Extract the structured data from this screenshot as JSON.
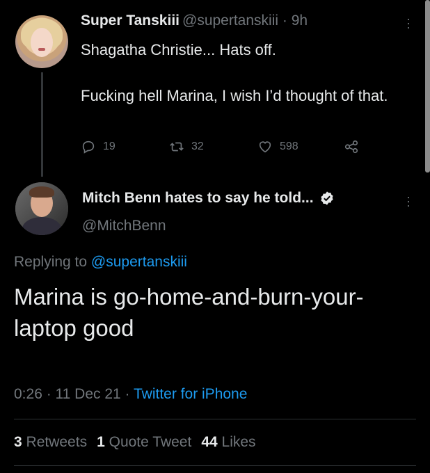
{
  "parent_tweet": {
    "display_name": "Super Tanskiii",
    "handle": "@supertanskiii",
    "time_sep": " · ",
    "time": "9h",
    "text_line1": "Shagatha Christie... Hats off.",
    "text_line2": "Fucking hell Marina, I wish I’d thought of that.",
    "replies": "19",
    "retweets": "32",
    "likes": "598"
  },
  "main_tweet": {
    "display_name": "Mitch Benn hates to say he told...",
    "handle": "@MitchBenn",
    "replying_prefix": "Replying to ",
    "replying_to": "@supertanskiii",
    "text": "Marina is go-home-and-burn-your-laptop good",
    "timestamp": "0:26 · 11 Dec 21 · ",
    "source": "Twitter for iPhone",
    "retweets_count": "3",
    "retweets_label": "Retweets",
    "quotes_count": "1",
    "quotes_label": "Quote Tweet",
    "likes_count": "44",
    "likes_label": "Likes"
  },
  "colors": {
    "background": "#000000",
    "text": "#e7e9ea",
    "muted": "#71767b",
    "accent": "#1d9bf0"
  },
  "icons": [
    "reply-icon",
    "retweet-icon",
    "like-icon",
    "share-icon",
    "verified-icon",
    "more-icon"
  ]
}
